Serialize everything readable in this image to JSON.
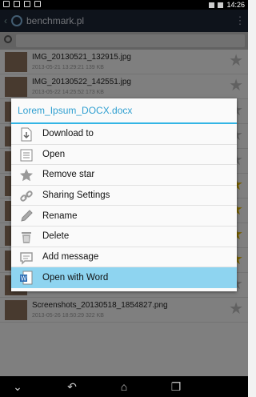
{
  "status_bar": {
    "time": "14:26"
  },
  "action_bar": {
    "title": "benchmark.pl",
    "back_icon": "chevron-left-icon",
    "overflow_icon": "overflow-menu-icon"
  },
  "search": {
    "placeholder": ""
  },
  "files": [
    {
      "name": "IMG_20130521_132915.jpg",
      "meta": "2013-05-21 13:29:21 139 KB",
      "starred": false
    },
    {
      "name": "IMG_20130522_142551.jpg",
      "meta": "2013-05-22 14:25:52 173 KB",
      "starred": false
    },
    {
      "name": "",
      "meta": "",
      "starred": false
    },
    {
      "name": "",
      "meta": "",
      "starred": false
    },
    {
      "name": "",
      "meta": "",
      "starred": false
    },
    {
      "name": "",
      "meta": "",
      "starred": true
    },
    {
      "name": "",
      "meta": "",
      "starred": true
    },
    {
      "name": "",
      "meta": "",
      "starred": true
    },
    {
      "name": "",
      "meta": "",
      "starred": true
    },
    {
      "name": "",
      "meta": "",
      "starred": false
    },
    {
      "name": "Screenshots_20130518_1854827.png",
      "meta": "2013-05-26 18:50:29 322 KB",
      "starred": false
    }
  ],
  "dialog": {
    "title": "Lorem_Ipsum_DOCX.docx",
    "items": [
      {
        "label": "Download to",
        "icon": "download-document-icon"
      },
      {
        "label": "Open",
        "icon": "open-document-icon"
      },
      {
        "label": "Remove star",
        "icon": "star-icon"
      },
      {
        "label": "Sharing Settings",
        "icon": "share-link-icon"
      },
      {
        "label": "Rename",
        "icon": "pencil-icon"
      },
      {
        "label": "Delete",
        "icon": "trash-icon"
      },
      {
        "label": "Add message",
        "icon": "speech-bubble-icon"
      },
      {
        "label": "Open with Word",
        "icon": "word-document-icon"
      }
    ]
  },
  "colors": {
    "accent": "#33b5e5",
    "highlight": "#8ed4f0",
    "action_bar": "#1c2635"
  }
}
